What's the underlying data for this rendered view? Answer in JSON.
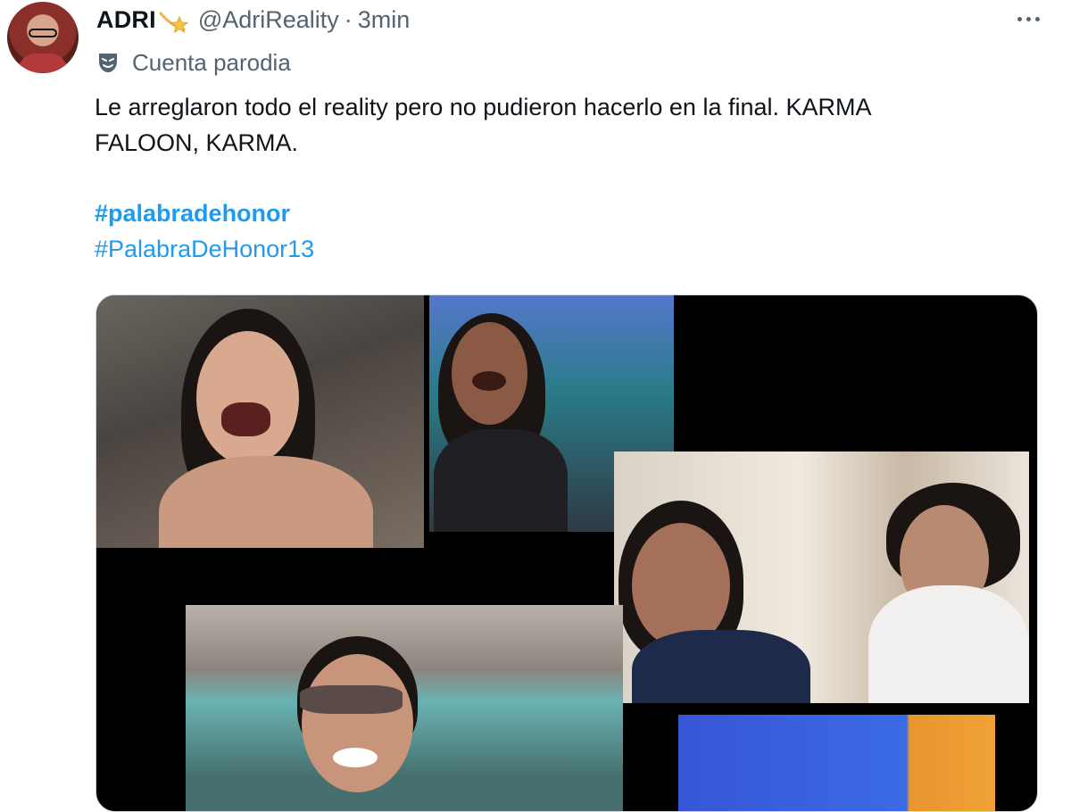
{
  "tweet": {
    "author": {
      "display_name": "ADRI",
      "handle": "@AdriReality",
      "separator": "·",
      "time": "3min",
      "badge_icon": "shooting-star-icon"
    },
    "parody_label": "Cuenta parodia",
    "parody_icon": "theater-mask-icon",
    "text": "Le arreglaron todo el reality pero no pudieron hacerlo en la final. KARMA\nFALOON, KARMA.",
    "hashtags": [
      "#palabradehonor",
      "#PalabraDeHonor13"
    ],
    "more_icon": "more-options-icon"
  },
  "colors": {
    "text": "#0f1419",
    "secondary": "#536471",
    "link": "#1d9bf0"
  }
}
